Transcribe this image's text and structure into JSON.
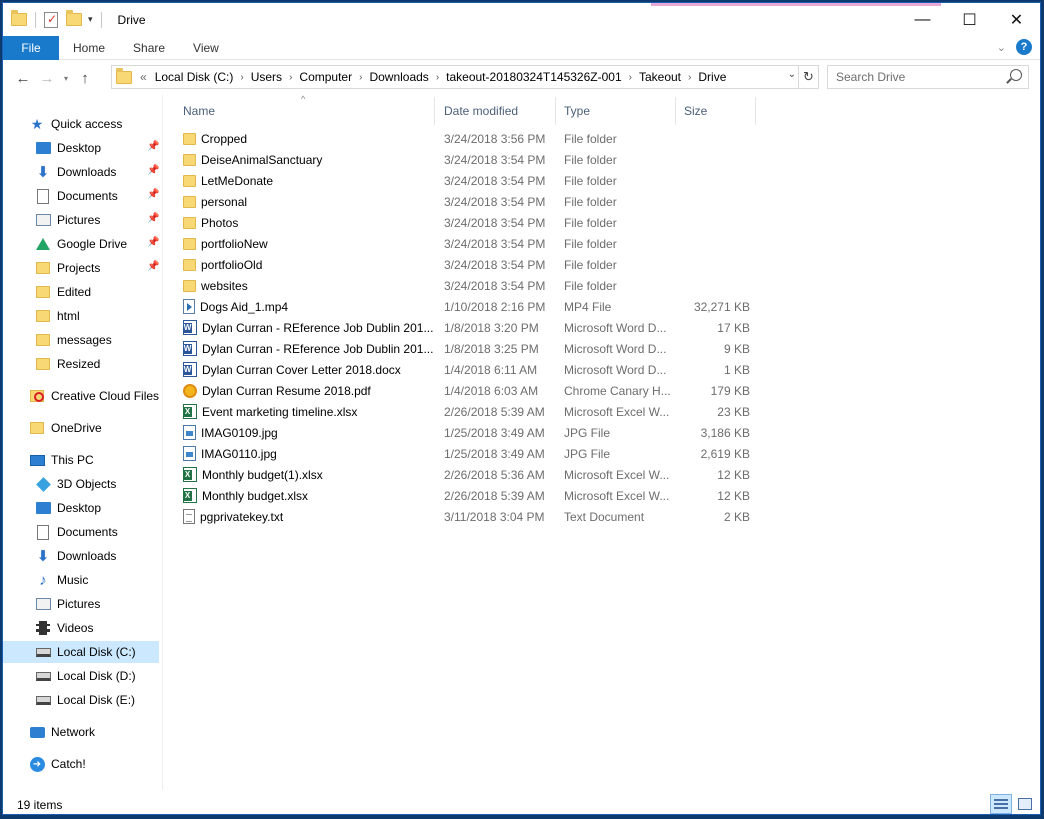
{
  "window": {
    "title": "Drive",
    "minimize": "—",
    "maximize": "☐",
    "close": "✕"
  },
  "ribbon": {
    "tabs": [
      "File",
      "Home",
      "Share",
      "View"
    ],
    "expand": "⌄",
    "help": "?"
  },
  "nav": {
    "back": "←",
    "forward": "→",
    "recent": "▾",
    "up": "↑",
    "refresh": "↻"
  },
  "address": {
    "overflow": "«",
    "crumbs": [
      "Local Disk (C:)",
      "Users",
      "Computer",
      "Downloads",
      "takeout-20180324T145326Z-001",
      "Takeout",
      "Drive"
    ],
    "sep": "›",
    "dropdown": "⌄"
  },
  "search": {
    "placeholder": "Search Drive"
  },
  "navpane": {
    "pin": "📌",
    "items": [
      {
        "label": "Quick access",
        "icon": "star-icon"
      },
      {
        "label": "Desktop",
        "icon": "desktop-icon",
        "pinned": true
      },
      {
        "label": "Downloads",
        "icon": "download-icon",
        "pinned": true
      },
      {
        "label": "Documents",
        "icon": "documents-icon",
        "pinned": true
      },
      {
        "label": "Pictures",
        "icon": "pictures-icon",
        "pinned": true
      },
      {
        "label": "Google Drive",
        "icon": "google-drive-icon",
        "pinned": true
      },
      {
        "label": "Projects",
        "icon": "folder-icon",
        "pinned": true
      },
      {
        "label": "Edited",
        "icon": "folder-icon"
      },
      {
        "label": "html",
        "icon": "folder-icon"
      },
      {
        "label": "messages",
        "icon": "folder-icon"
      },
      {
        "label": "Resized",
        "icon": "folder-icon"
      },
      {
        "label": "Creative Cloud Files",
        "icon": "creative-cloud-icon"
      },
      {
        "label": "OneDrive",
        "icon": "onedrive-icon"
      },
      {
        "label": "This PC",
        "icon": "pc-icon"
      },
      {
        "label": "3D Objects",
        "icon": "3d-objects-icon"
      },
      {
        "label": "Desktop",
        "icon": "desktop-icon"
      },
      {
        "label": "Documents",
        "icon": "documents-icon"
      },
      {
        "label": "Downloads",
        "icon": "download-icon"
      },
      {
        "label": "Music",
        "icon": "music-icon"
      },
      {
        "label": "Pictures",
        "icon": "pictures-icon"
      },
      {
        "label": "Videos",
        "icon": "videos-icon"
      },
      {
        "label": "Local Disk (C:)",
        "icon": "drive-icon",
        "selected": true
      },
      {
        "label": "Local Disk (D:)",
        "icon": "drive-icon"
      },
      {
        "label": "Local Disk (E:)",
        "icon": "drive-icon"
      },
      {
        "label": "Network",
        "icon": "network-icon"
      },
      {
        "label": "Catch!",
        "icon": "catch-icon"
      }
    ]
  },
  "columns": {
    "name": "Name",
    "date": "Date modified",
    "type": "Type",
    "size": "Size",
    "sort_indicator": "^"
  },
  "files": [
    {
      "name": "Cropped",
      "date": "3/24/2018 3:56 PM",
      "type": "File folder",
      "size": "",
      "icon": "folder-icon"
    },
    {
      "name": "DeiseAnimalSanctuary",
      "date": "3/24/2018 3:54 PM",
      "type": "File folder",
      "size": "",
      "icon": "folder-icon"
    },
    {
      "name": "LetMeDonate",
      "date": "3/24/2018 3:54 PM",
      "type": "File folder",
      "size": "",
      "icon": "folder-icon"
    },
    {
      "name": "personal",
      "date": "3/24/2018 3:54 PM",
      "type": "File folder",
      "size": "",
      "icon": "folder-icon"
    },
    {
      "name": "Photos",
      "date": "3/24/2018 3:54 PM",
      "type": "File folder",
      "size": "",
      "icon": "folder-icon"
    },
    {
      "name": "portfolioNew",
      "date": "3/24/2018 3:54 PM",
      "type": "File folder",
      "size": "",
      "icon": "folder-icon"
    },
    {
      "name": "portfolioOld",
      "date": "3/24/2018 3:54 PM",
      "type": "File folder",
      "size": "",
      "icon": "folder-icon"
    },
    {
      "name": "websites",
      "date": "3/24/2018 3:54 PM",
      "type": "File folder",
      "size": "",
      "icon": "folder-icon"
    },
    {
      "name": "Dogs Aid_1.mp4",
      "date": "1/10/2018 2:16 PM",
      "type": "MP4 File",
      "size": "32,271 KB",
      "icon": "video-file-icon"
    },
    {
      "name": "Dylan Curran - REference Job Dublin 201...",
      "date": "1/8/2018 3:20 PM",
      "type": "Microsoft Word D...",
      "size": "17 KB",
      "icon": "word-file-icon"
    },
    {
      "name": "Dylan Curran - REference Job Dublin 201...",
      "date": "1/8/2018 3:25 PM",
      "type": "Microsoft Word D...",
      "size": "9 KB",
      "icon": "word-file-icon"
    },
    {
      "name": "Dylan Curran Cover Letter 2018.docx",
      "date": "1/4/2018 6:11 AM",
      "type": "Microsoft Word D...",
      "size": "1 KB",
      "icon": "word-file-icon"
    },
    {
      "name": "Dylan Curran Resume 2018.pdf",
      "date": "1/4/2018 6:03 AM",
      "type": "Chrome Canary H...",
      "size": "179 KB",
      "icon": "pdf-file-icon"
    },
    {
      "name": "Event marketing timeline.xlsx",
      "date": "2/26/2018 5:39 AM",
      "type": "Microsoft Excel W...",
      "size": "23 KB",
      "icon": "excel-file-icon"
    },
    {
      "name": "IMAG0109.jpg",
      "date": "1/25/2018 3:49 AM",
      "type": "JPG File",
      "size": "3,186 KB",
      "icon": "image-file-icon"
    },
    {
      "name": "IMAG0110.jpg",
      "date": "1/25/2018 3:49 AM",
      "type": "JPG File",
      "size": "2,619 KB",
      "icon": "image-file-icon"
    },
    {
      "name": "Monthly budget(1).xlsx",
      "date": "2/26/2018 5:36 AM",
      "type": "Microsoft Excel W...",
      "size": "12 KB",
      "icon": "excel-file-icon"
    },
    {
      "name": "Monthly budget.xlsx",
      "date": "2/26/2018 5:39 AM",
      "type": "Microsoft Excel W...",
      "size": "12 KB",
      "icon": "excel-file-icon"
    },
    {
      "name": "pgprivatekey.txt",
      "date": "3/11/2018 3:04 PM",
      "type": "Text Document",
      "size": "2 KB",
      "icon": "text-file-icon"
    }
  ],
  "status": {
    "item_count": "19 items"
  },
  "colors": {
    "accent": "#1979ca",
    "selected": "#cce8ff",
    "folder": "#f8d775"
  }
}
